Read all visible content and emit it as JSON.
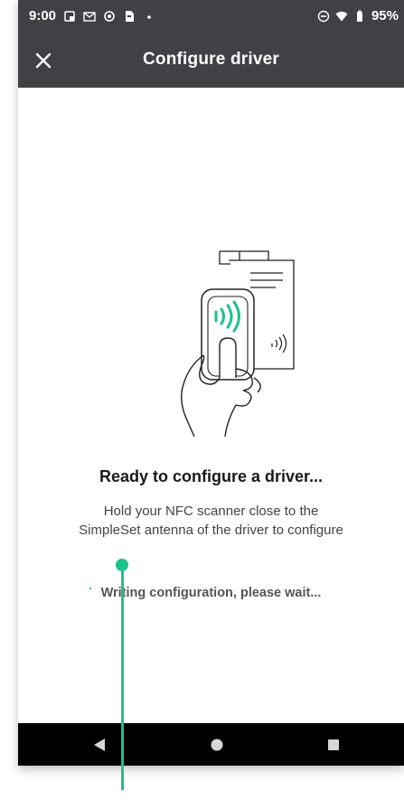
{
  "status_bar": {
    "time": "9:00",
    "battery": "95%",
    "icons": [
      "screenshot-icon",
      "gmail-icon",
      "settings-icon",
      "sim-icon",
      "dot-icon",
      "dnd-icon",
      "wifi-icon",
      "battery-icon"
    ]
  },
  "app_bar": {
    "title": "Configure driver",
    "close_icon": "close-icon"
  },
  "main": {
    "heading": "Ready to configure a driver...",
    "instruction_line1": "Hold your NFC scanner close to the",
    "instruction_line2": "SimpleSet antenna of the driver to configure",
    "progress_text": "Writing configuration, please wait..."
  },
  "nav": {
    "back_icon": "back-triangle-icon",
    "home_icon": "home-circle-icon",
    "recents_icon": "recents-square-icon"
  },
  "colors": {
    "accent": "#1ec28b",
    "bar": "#3f4144",
    "nav": "#000000"
  }
}
